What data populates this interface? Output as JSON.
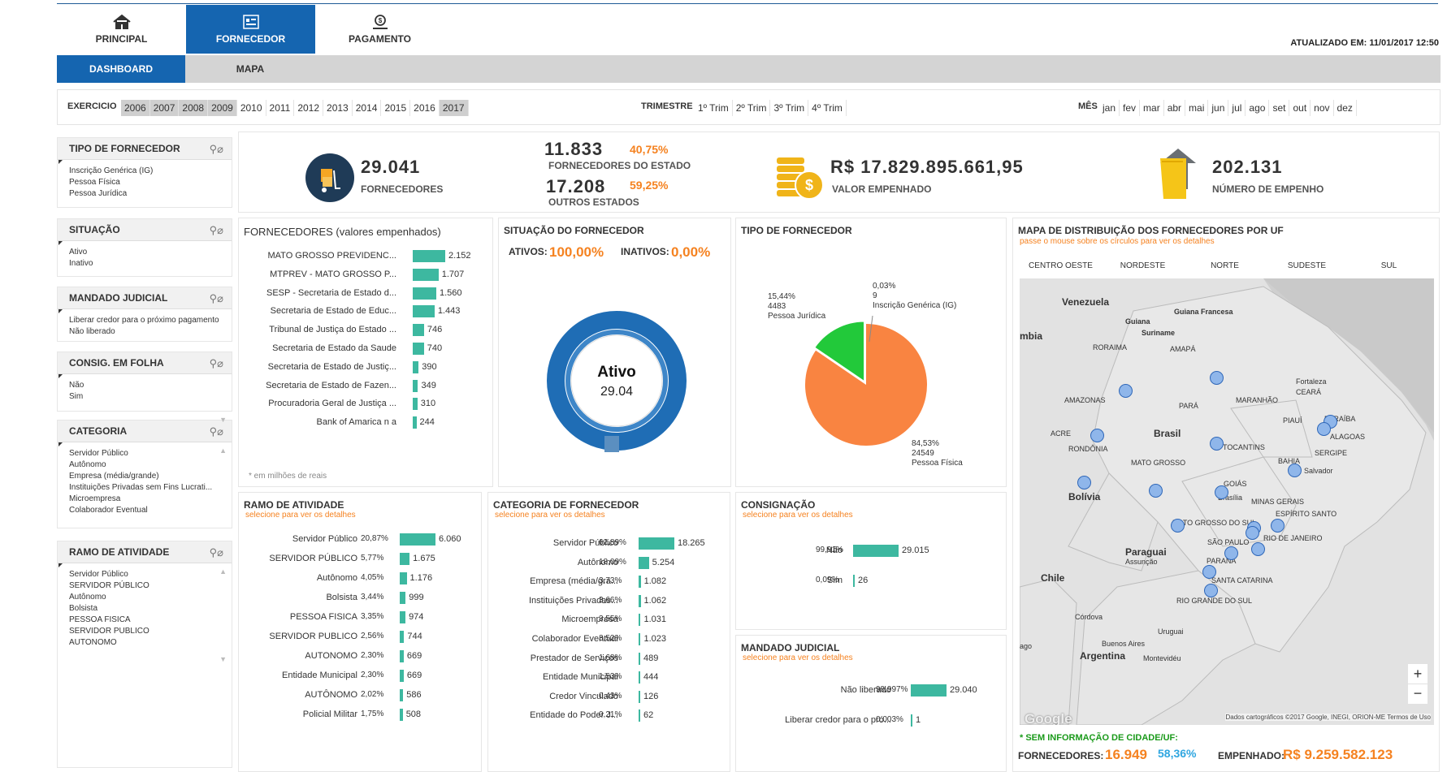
{
  "nav": {
    "tabs": [
      {
        "label": "PRINCIPAL",
        "icon": "home-icon"
      },
      {
        "label": "FORNECEDOR",
        "icon": "supplier-icon"
      },
      {
        "label": "PAGAMENTO",
        "icon": "payment-icon"
      }
    ],
    "active": "FORNECEDOR",
    "updated": "ATUALIZADO EM: 11/01/2017 12:50"
  },
  "subnav": {
    "tabs": [
      "DASHBOARD",
      "MAPA"
    ]
  },
  "filters": {
    "exercicio_label": "EXERCICIO",
    "years": [
      "2006",
      "2007",
      "2008",
      "2009",
      "2010",
      "2011",
      "2012",
      "2013",
      "2014",
      "2015",
      "2016",
      "2017"
    ],
    "trimestre_label": "TRIMESTRE",
    "trimestres": [
      "1º Trim",
      "2º Trim",
      "3º Trim",
      "4º Trim"
    ],
    "mes_label": "MÊS",
    "meses": [
      "jan",
      "fev",
      "mar",
      "abr",
      "mai",
      "jun",
      "jul",
      "ago",
      "set",
      "out",
      "nov",
      "dez"
    ]
  },
  "sidebar": [
    {
      "title": "TIPO DE FORNECEDOR",
      "items": [
        "Inscrição Genérica (IG)",
        "Pessoa Física",
        "Pessoa Jurídica"
      ]
    },
    {
      "title": "SITUAÇÃO",
      "items": [
        "Ativo",
        "Inativo"
      ]
    },
    {
      "title": "MANDADO JUDICIAL",
      "items": [
        "Liberar credor para o próximo pagamento",
        "Não liberado"
      ]
    },
    {
      "title": "CONSIG. EM FOLHA",
      "items": [
        "Não",
        "Sim"
      ]
    },
    {
      "title": "CATEGORIA",
      "items": [
        "Servidor Público",
        "Autônomo",
        "Empresa (média/grande)",
        "Instituições Privadas sem Fins Lucrati...",
        "Microempresa",
        "Colaborador Eventual"
      ]
    },
    {
      "title": "RAMO DE ATIVIDADE",
      "items": [
        "Servidor Público",
        "SERVIDOR PÚBLICO",
        "Autônomo",
        "Bolsista",
        "PESSOA FISICA",
        "SERVIDOR PUBLICO",
        "AUTONOMO"
      ]
    }
  ],
  "kpis": {
    "fornecedores_value": "29.041",
    "fornecedores_label": "FORNECEDORES",
    "estado_value": "11.833",
    "estado_pct": "40,75%",
    "estado_label": "FORNECEDORES DO ESTADO",
    "outros_value": "17.208",
    "outros_pct": "59,25%",
    "outros_label": "OUTROS ESTADOS",
    "empenhado_value": "R$ 17.829.895.661,95",
    "empenhado_label": "VALOR EMPENHADO",
    "numero_value": "202.131",
    "numero_label": "NÚMERO DE EMPENHO"
  },
  "fornecedores_chart": {
    "title": "FORNECEDORES (valores empenhados)",
    "note": "* em milhões de reais"
  },
  "situacao": {
    "title": "SITUAÇÃO DO FORNECEDOR",
    "ativos_label": "ATIVOS:",
    "ativos_pct": "100,00%",
    "inativos_label": "INATIVOS:",
    "inativos_pct": "0,00%",
    "center_label": "Ativo",
    "center_value": "29.04"
  },
  "tipo": {
    "title": "TIPO DE FORNECEDOR",
    "lbl_ig": [
      "0,03%",
      "9",
      "Inscrição Genérica (IG)"
    ],
    "lbl_pj": [
      "15,44%",
      "4483",
      "Pessoa Jurídica"
    ],
    "lbl_pf": [
      "84,53%",
      "24549",
      "Pessoa Física"
    ]
  },
  "mapa": {
    "title": "MAPA DE DISTRIBUIÇÃO DOS FORNECEDORES POR UF",
    "subtitle": "passe o mouse sobre os círculos para ver os detalhes",
    "regions": [
      "CENTRO OESTE",
      "NORDESTE",
      "NORTE",
      "SUDESTE",
      "SUL"
    ],
    "attribution": "Dados cartográficos ©2017 Google, INEGI, ORION-ME   Termos de Uso",
    "google": "Google",
    "zoom_in": "+",
    "zoom_out": "−",
    "places": [
      "Venezuela",
      "Guiana",
      "Guiana Francesa",
      "Suriname",
      "RORAIMA",
      "AMAPÁ",
      "AMAZONAS",
      "PARÁ",
      "MARANHÃO",
      "CEARÁ",
      "Fortaleza",
      "PIAUÍ",
      "PARAÍBA",
      "ALAGOAS",
      "SERGIPE",
      "Salvador",
      "BAHIA",
      "ACRE",
      "RONDÔNIA",
      "Brasil",
      "TOCANTINS",
      "MATO GROSSO",
      "GOIÁS",
      "Brasília",
      "MINAS GERAIS",
      "ESPÍRITO SANTO",
      "MATO GROSSO DO SUL",
      "SÃO PAULO",
      "RIO DE JANEIRO",
      "Bolívia",
      "Paraguai",
      "Assunção",
      "PARANÁ",
      "SANTA CATARINA",
      "RIO GRANDE DO SUL",
      "Chile",
      "Córdova",
      "Uruguai",
      "Buenos Aires",
      "Argentina",
      "Montevidéu",
      "mbia",
      "ago"
    ],
    "sem_info": "* SEM INFORMAÇÃO DE CIDADE/UF:",
    "forn_label": "FORNECEDORES:",
    "forn_value": "16.949",
    "forn_pct": "58,36%",
    "emp_label": "EMPENHADO:",
    "emp_value": "R$ 9.259.582.123"
  },
  "ramo": {
    "title": "RAMO DE ATIVIDADE",
    "subtitle": "selecione para ver os detalhes"
  },
  "categoria": {
    "title": "CATEGORIA DE FORNECEDOR",
    "subtitle": "selecione para ver os detalhes"
  },
  "consig": {
    "title": "CONSIGNAÇÃO",
    "subtitle": "selecione para ver os detalhes"
  },
  "mandado": {
    "title": "MANDADO JUDICIAL",
    "subtitle": "selecione para ver os detalhes"
  },
  "colors": {
    "accent": "#1565b0",
    "bar": "#3db8a0",
    "orange": "#f58220",
    "green": "#1a9a1a",
    "pie_pf": "#f98441",
    "pie_pj": "#22c93a"
  },
  "chart_data": [
    {
      "type": "bar",
      "id": "fornecedores",
      "categories": [
        "MATO GROSSO PREVIDENC...",
        "MTPREV - MATO GROSSO P...",
        "SESP - Secretaria de Estado d...",
        "Secretaria de Estado de Educ...",
        "Tribunal de Justiça do Estado ...",
        "Secretaria de Estado da Saude",
        "Secretaria de Estado de Justiç...",
        "Secretaria de Estado de Fazen...",
        "Procuradoria Geral de Justiça ...",
        "Bank of Amarica n a"
      ],
      "values": [
        2152,
        1707,
        1560,
        1443,
        746,
        740,
        390,
        349,
        310,
        244
      ],
      "labels": [
        "2.152",
        "1.707",
        "1.560",
        "1.443",
        "746",
        "740",
        "390",
        "349",
        "310",
        "244"
      ]
    },
    {
      "type": "bar",
      "id": "ramo",
      "categories": [
        "Servidor Público",
        "SERVIDOR PÚBLICO",
        "Autônomo",
        "Bolsista",
        "PESSOA FISICA",
        "SERVIDOR PUBLICO",
        "AUTONOMO",
        "Entidade Municipal",
        "AUTÔNOMO",
        "Policial Militar"
      ],
      "pcts": [
        "20,87%",
        "5,77%",
        "4,05%",
        "3,44%",
        "3,35%",
        "2,56%",
        "2,30%",
        "2,30%",
        "2,02%",
        "1,75%"
      ],
      "values": [
        6060,
        1675,
        1176,
        999,
        974,
        744,
        669,
        669,
        586,
        508
      ],
      "labels": [
        "6.060",
        "1.675",
        "1.176",
        "999",
        "974",
        "744",
        "669",
        "669",
        "586",
        "508"
      ]
    },
    {
      "type": "bar",
      "id": "categoria",
      "categories": [
        "Servidor Público",
        "Autônomo",
        "Empresa (média/gra...",
        "Instituições Privadas...",
        "Microempresa",
        "Colaborador Eventual",
        "Prestador de Serviços",
        "Entidade Municipal",
        "Credor Vinculado",
        "Entidade do Poder J..."
      ],
      "pcts": [
        "62,89%",
        "18,09%",
        "3,73%",
        "3,66%",
        "3,55%",
        "3,52%",
        "1,68%",
        "1,53%",
        "0,43%",
        "0,21%"
      ],
      "values": [
        18265,
        5254,
        1082,
        1062,
        1031,
        1023,
        489,
        444,
        126,
        62
      ],
      "labels": [
        "18.265",
        "5.254",
        "1.082",
        "1.062",
        "1.031",
        "1.023",
        "489",
        "444",
        "126",
        "62"
      ]
    },
    {
      "type": "bar",
      "id": "consig",
      "categories": [
        "Não",
        "Sim"
      ],
      "pcts": [
        "99,91%",
        "0,09%"
      ],
      "values": [
        29015,
        26
      ],
      "labels": [
        "29.015",
        "26"
      ]
    },
    {
      "type": "bar",
      "id": "mandado",
      "categories": [
        "Não liberado",
        "Liberar credor para o pró..."
      ],
      "pcts": [
        "99,997%",
        "0,003%"
      ],
      "values": [
        29040,
        1
      ],
      "labels": [
        "29.040",
        "1"
      ]
    },
    {
      "type": "pie",
      "id": "tipo",
      "categories": [
        "Pessoa Física",
        "Pessoa Jurídica",
        "Inscrição Genérica (IG)"
      ],
      "values": [
        24549,
        4483,
        9
      ],
      "pcts": [
        "84,53%",
        "15,44%",
        "0,03%"
      ]
    },
    {
      "type": "pie",
      "id": "situacao",
      "categories": [
        "Ativo",
        "Inativo"
      ],
      "values": [
        100,
        0
      ]
    }
  ]
}
